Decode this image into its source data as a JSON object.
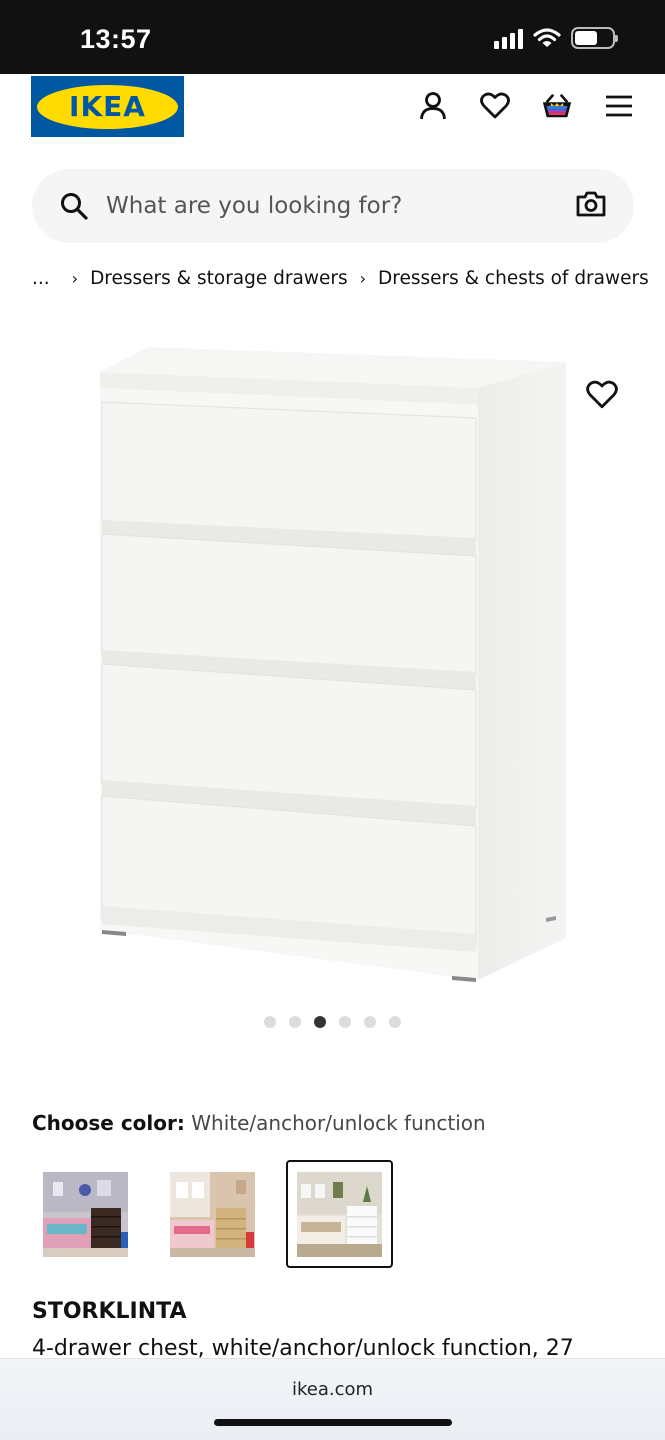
{
  "status_bar": {
    "time": "13:57",
    "icons": [
      "signal-icon",
      "wifi-icon",
      "battery-icon"
    ]
  },
  "header": {
    "logo_text": "IKEA",
    "icons": [
      "account-icon",
      "heart-icon",
      "basket-icon",
      "menu-icon"
    ]
  },
  "search": {
    "placeholder": "What are you looking for?"
  },
  "breadcrumb": {
    "ellipsis": "...",
    "items": [
      "Dressers & storage drawers",
      "Dressers & chests of drawers"
    ]
  },
  "carousel": {
    "count": 6,
    "active_index": 2
  },
  "color_picker": {
    "label": "Choose color:",
    "value": "White/anchor/unlock function",
    "selected_index": 2
  },
  "product": {
    "name": "STORKLINTA",
    "description": "4-drawer chest, white/anchor/unlock function, 27"
  },
  "browser": {
    "url": "ikea.com"
  },
  "colors": {
    "brand_blue": "#0058a3",
    "brand_yellow": "#ffdb00"
  }
}
